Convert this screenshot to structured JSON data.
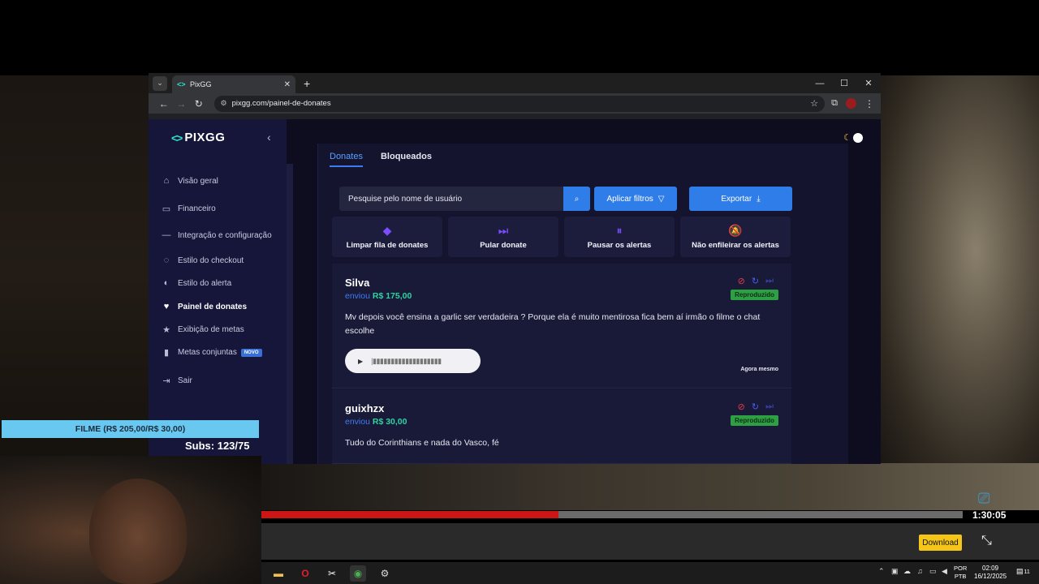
{
  "browser": {
    "tab_title": "PixGG",
    "url": "pixgg.com/painel-de-donates"
  },
  "brand": {
    "logo_text": "PIXGG",
    "accent": "#2de0c0"
  },
  "sidebar": {
    "items": [
      {
        "label": "Visão geral",
        "icon": "home-icon"
      },
      {
        "label": "Financeiro",
        "icon": "wallet-icon"
      },
      {
        "label": "Integração e configuração",
        "icon": "plug-icon"
      },
      {
        "label": "Estilo do checkout",
        "icon": "cart-icon"
      },
      {
        "label": "Estilo do alerta",
        "icon": "palette-icon"
      },
      {
        "label": "Painel de donates",
        "icon": "donate-icon"
      },
      {
        "label": "Exibição de metas",
        "icon": "star-icon"
      },
      {
        "label": "Metas conjuntas",
        "icon": "chart-icon",
        "badge": "NOVO"
      },
      {
        "label": "Sair",
        "icon": "logout-icon"
      }
    ],
    "active_index": 5
  },
  "tabs": [
    {
      "label": "Donates",
      "active": true
    },
    {
      "label": "Bloqueados",
      "active": false
    }
  ],
  "search": {
    "placeholder": "Pesquise pelo nome de usuário"
  },
  "buttons": {
    "filters": "Aplicar filtros",
    "export": "Exportar"
  },
  "actions": [
    {
      "label": "Limpar fila de donates",
      "icon": "eraser-icon"
    },
    {
      "label": "Pular donate",
      "icon": "skip-icon"
    },
    {
      "label": "Pausar os alertas",
      "icon": "pause-icon"
    },
    {
      "label": "Não enfileirar os alertas",
      "icon": "bell-off-icon"
    }
  ],
  "donates": [
    {
      "name": "Silva",
      "verb": "enviou",
      "amount": "R$ 175,00",
      "status": "Reproduzido",
      "message": "Mv depois você ensina a garlic ser verdadeira ? Porque ela é muito mentirosa fica bem aí irmão o filme o chat escolhe",
      "time": "Agora mesmo"
    },
    {
      "name": "guixhzx",
      "verb": "enviou",
      "amount": "R$ 30,00",
      "status": "Reproduzido",
      "message": "Tudo do Corinthians e nada do Vasco, fé"
    }
  ],
  "stream": {
    "goal_text": "FILME (R$ 205,00/R$ 30,00)",
    "subs_text": "Subs: 123/75"
  },
  "video": {
    "time": "1:30:05",
    "progress": 0.424,
    "download_label": "Download"
  },
  "taskbar": {
    "lang_line1": "POR",
    "lang_line2": "PTB",
    "clock_time": "02:09",
    "clock_date": "16/12/2025",
    "notification_count": "11"
  }
}
